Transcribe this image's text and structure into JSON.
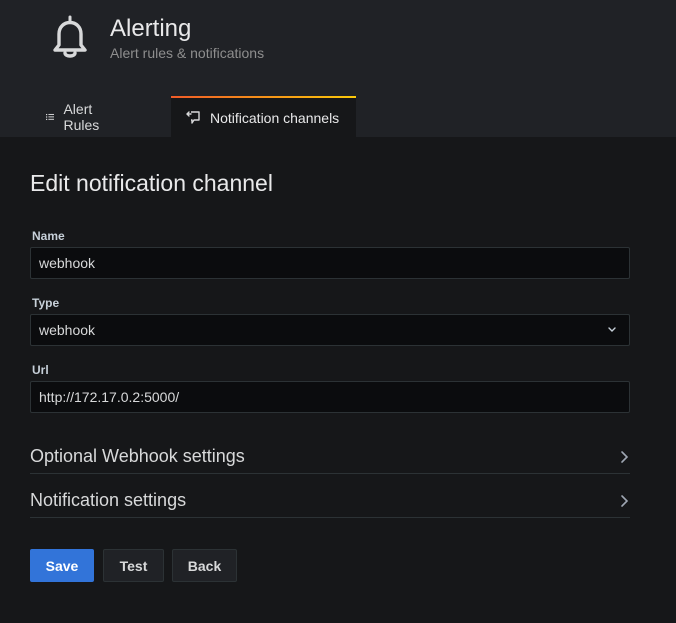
{
  "header": {
    "title": "Alerting",
    "subtitle": "Alert rules & notifications",
    "icon": "bell-icon"
  },
  "tabs": [
    {
      "label": "Alert Rules",
      "icon": "list-icon",
      "active": false
    },
    {
      "label": "Notification channels",
      "icon": "comment-alt-share-icon",
      "active": true
    }
  ],
  "form": {
    "title": "Edit notification channel",
    "name_label": "Name",
    "name_value": "webhook",
    "type_label": "Type",
    "type_value": "webhook",
    "url_label": "Url",
    "url_value": "http://172.17.0.2:5000/"
  },
  "sections": [
    {
      "title": "Optional Webhook settings"
    },
    {
      "title": "Notification settings"
    }
  ],
  "actions": {
    "save_label": "Save",
    "test_label": "Test",
    "back_label": "Back"
  },
  "colors": {
    "primary": "#3274d9",
    "background": "#161719",
    "header": "#202226",
    "tab_accent_start": "#f05a28",
    "tab_accent_end": "#fbca0a"
  }
}
